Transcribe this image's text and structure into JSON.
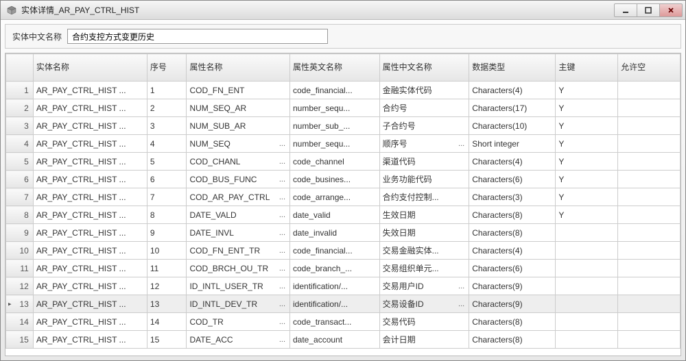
{
  "window": {
    "title": "实体详情_AR_PAY_CTRL_HIST"
  },
  "form": {
    "label_cn_name": "实体中文名称",
    "value_cn_name": "合约支控方式变更历史"
  },
  "columns": {
    "entity_name": "实体名称",
    "seq": "序号",
    "attr_name": "属性名称",
    "attr_eng": "属性英文名称",
    "attr_chn": "属性中文名称",
    "data_type": "数据类型",
    "pk": "主键",
    "allow_null": "允许空"
  },
  "selected_row": 13,
  "rows": [
    {
      "n": 1,
      "entity": "AR_PAY_CTRL_HIST ...",
      "seq": "1",
      "attr": "COD_FN_ENT",
      "attr_d": false,
      "eng": "code_financial...",
      "chn": "金融实体代码",
      "chn_d": false,
      "type": "Characters(4)",
      "pk": "Y",
      "nul": ""
    },
    {
      "n": 2,
      "entity": "AR_PAY_CTRL_HIST ...",
      "seq": "2",
      "attr": "NUM_SEQ_AR",
      "attr_d": false,
      "eng": "number_sequ...",
      "chn": "合约号",
      "chn_d": false,
      "type": "Characters(17)",
      "pk": "Y",
      "nul": ""
    },
    {
      "n": 3,
      "entity": "AR_PAY_CTRL_HIST ...",
      "seq": "3",
      "attr": "NUM_SUB_AR",
      "attr_d": false,
      "eng": "number_sub_...",
      "chn": "子合约号",
      "chn_d": false,
      "type": "Characters(10)",
      "pk": "Y",
      "nul": ""
    },
    {
      "n": 4,
      "entity": "AR_PAY_CTRL_HIST ...",
      "seq": "4",
      "attr": "NUM_SEQ",
      "attr_d": true,
      "eng": "number_sequ...",
      "chn": "顺序号",
      "chn_d": true,
      "type": "Short integer",
      "pk": "Y",
      "nul": ""
    },
    {
      "n": 5,
      "entity": "AR_PAY_CTRL_HIST ...",
      "seq": "5",
      "attr": "COD_CHANL",
      "attr_d": true,
      "eng": "code_channel",
      "chn": "渠道代码",
      "chn_d": false,
      "type": "Characters(4)",
      "pk": "Y",
      "nul": ""
    },
    {
      "n": 6,
      "entity": "AR_PAY_CTRL_HIST ...",
      "seq": "6",
      "attr": "COD_BUS_FUNC",
      "attr_d": true,
      "eng": "code_busines...",
      "chn": "业务功能代码",
      "chn_d": false,
      "type": "Characters(6)",
      "pk": "Y",
      "nul": ""
    },
    {
      "n": 7,
      "entity": "AR_PAY_CTRL_HIST ...",
      "seq": "7",
      "attr": "COD_AR_PAY_CTRL",
      "attr_d": true,
      "eng": "code_arrange...",
      "chn": "合约支付控制...",
      "chn_d": false,
      "type": "Characters(3)",
      "pk": "Y",
      "nul": ""
    },
    {
      "n": 8,
      "entity": "AR_PAY_CTRL_HIST ...",
      "seq": "8",
      "attr": "DATE_VALD",
      "attr_d": true,
      "eng": "date_valid",
      "chn": "生效日期",
      "chn_d": false,
      "type": "Characters(8)",
      "pk": "Y",
      "nul": ""
    },
    {
      "n": 9,
      "entity": "AR_PAY_CTRL_HIST ...",
      "seq": "9",
      "attr": "DATE_INVL",
      "attr_d": true,
      "eng": "date_invalid",
      "chn": "失效日期",
      "chn_d": false,
      "type": "Characters(8)",
      "pk": "",
      "nul": ""
    },
    {
      "n": 10,
      "entity": "AR_PAY_CTRL_HIST ...",
      "seq": "10",
      "attr": "COD_FN_ENT_TR",
      "attr_d": true,
      "eng": "code_financial...",
      "chn": "交易金融实体...",
      "chn_d": false,
      "type": "Characters(4)",
      "pk": "",
      "nul": ""
    },
    {
      "n": 11,
      "entity": "AR_PAY_CTRL_HIST ...",
      "seq": "11",
      "attr": "COD_BRCH_OU_TR",
      "attr_d": true,
      "eng": "code_branch_...",
      "chn": "交易组织单元...",
      "chn_d": false,
      "type": "Characters(6)",
      "pk": "",
      "nul": ""
    },
    {
      "n": 12,
      "entity": "AR_PAY_CTRL_HIST ...",
      "seq": "12",
      "attr": "ID_INTL_USER_TR",
      "attr_d": true,
      "eng": "identification/...",
      "chn": "交易用户ID",
      "chn_d": true,
      "type": "Characters(9)",
      "pk": "",
      "nul": ""
    },
    {
      "n": 13,
      "entity": "AR_PAY_CTRL_HIST ...",
      "seq": "13",
      "attr": "ID_INTL_DEV_TR",
      "attr_d": true,
      "eng": "identification/...",
      "chn": "交易设备ID",
      "chn_d": true,
      "type": "Characters(9)",
      "pk": "",
      "nul": ""
    },
    {
      "n": 14,
      "entity": "AR_PAY_CTRL_HIST ...",
      "seq": "14",
      "attr": "COD_TR",
      "attr_d": true,
      "eng": "code_transact...",
      "chn": "交易代码",
      "chn_d": false,
      "type": "Characters(8)",
      "pk": "",
      "nul": ""
    },
    {
      "n": 15,
      "entity": "AR_PAY_CTRL_HIST ...",
      "seq": "15",
      "attr": "DATE_ACC",
      "attr_d": true,
      "eng": "date_account",
      "chn": "会计日期",
      "chn_d": false,
      "type": "Characters(8)",
      "pk": "",
      "nul": ""
    }
  ]
}
